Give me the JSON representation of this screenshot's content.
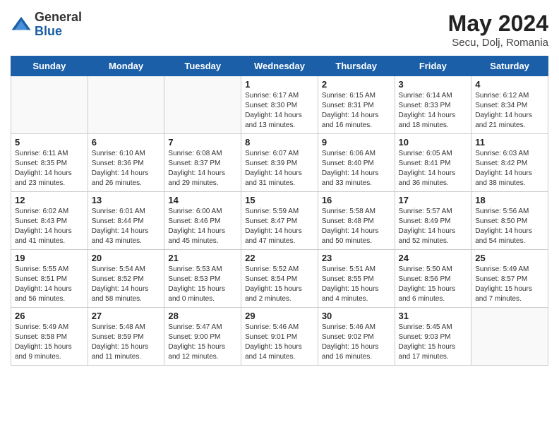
{
  "logo": {
    "general": "General",
    "blue": "Blue"
  },
  "title": {
    "month_year": "May 2024",
    "location": "Secu, Dolj, Romania"
  },
  "days_of_week": [
    "Sunday",
    "Monday",
    "Tuesday",
    "Wednesday",
    "Thursday",
    "Friday",
    "Saturday"
  ],
  "weeks": [
    [
      {
        "day": "",
        "info": ""
      },
      {
        "day": "",
        "info": ""
      },
      {
        "day": "",
        "info": ""
      },
      {
        "day": "1",
        "info": "Sunrise: 6:17 AM\nSunset: 8:30 PM\nDaylight: 14 hours\nand 13 minutes."
      },
      {
        "day": "2",
        "info": "Sunrise: 6:15 AM\nSunset: 8:31 PM\nDaylight: 14 hours\nand 16 minutes."
      },
      {
        "day": "3",
        "info": "Sunrise: 6:14 AM\nSunset: 8:33 PM\nDaylight: 14 hours\nand 18 minutes."
      },
      {
        "day": "4",
        "info": "Sunrise: 6:12 AM\nSunset: 8:34 PM\nDaylight: 14 hours\nand 21 minutes."
      }
    ],
    [
      {
        "day": "5",
        "info": "Sunrise: 6:11 AM\nSunset: 8:35 PM\nDaylight: 14 hours\nand 23 minutes."
      },
      {
        "day": "6",
        "info": "Sunrise: 6:10 AM\nSunset: 8:36 PM\nDaylight: 14 hours\nand 26 minutes."
      },
      {
        "day": "7",
        "info": "Sunrise: 6:08 AM\nSunset: 8:37 PM\nDaylight: 14 hours\nand 29 minutes."
      },
      {
        "day": "8",
        "info": "Sunrise: 6:07 AM\nSunset: 8:39 PM\nDaylight: 14 hours\nand 31 minutes."
      },
      {
        "day": "9",
        "info": "Sunrise: 6:06 AM\nSunset: 8:40 PM\nDaylight: 14 hours\nand 33 minutes."
      },
      {
        "day": "10",
        "info": "Sunrise: 6:05 AM\nSunset: 8:41 PM\nDaylight: 14 hours\nand 36 minutes."
      },
      {
        "day": "11",
        "info": "Sunrise: 6:03 AM\nSunset: 8:42 PM\nDaylight: 14 hours\nand 38 minutes."
      }
    ],
    [
      {
        "day": "12",
        "info": "Sunrise: 6:02 AM\nSunset: 8:43 PM\nDaylight: 14 hours\nand 41 minutes."
      },
      {
        "day": "13",
        "info": "Sunrise: 6:01 AM\nSunset: 8:44 PM\nDaylight: 14 hours\nand 43 minutes."
      },
      {
        "day": "14",
        "info": "Sunrise: 6:00 AM\nSunset: 8:46 PM\nDaylight: 14 hours\nand 45 minutes."
      },
      {
        "day": "15",
        "info": "Sunrise: 5:59 AM\nSunset: 8:47 PM\nDaylight: 14 hours\nand 47 minutes."
      },
      {
        "day": "16",
        "info": "Sunrise: 5:58 AM\nSunset: 8:48 PM\nDaylight: 14 hours\nand 50 minutes."
      },
      {
        "day": "17",
        "info": "Sunrise: 5:57 AM\nSunset: 8:49 PM\nDaylight: 14 hours\nand 52 minutes."
      },
      {
        "day": "18",
        "info": "Sunrise: 5:56 AM\nSunset: 8:50 PM\nDaylight: 14 hours\nand 54 minutes."
      }
    ],
    [
      {
        "day": "19",
        "info": "Sunrise: 5:55 AM\nSunset: 8:51 PM\nDaylight: 14 hours\nand 56 minutes."
      },
      {
        "day": "20",
        "info": "Sunrise: 5:54 AM\nSunset: 8:52 PM\nDaylight: 14 hours\nand 58 minutes."
      },
      {
        "day": "21",
        "info": "Sunrise: 5:53 AM\nSunset: 8:53 PM\nDaylight: 15 hours\nand 0 minutes."
      },
      {
        "day": "22",
        "info": "Sunrise: 5:52 AM\nSunset: 8:54 PM\nDaylight: 15 hours\nand 2 minutes."
      },
      {
        "day": "23",
        "info": "Sunrise: 5:51 AM\nSunset: 8:55 PM\nDaylight: 15 hours\nand 4 minutes."
      },
      {
        "day": "24",
        "info": "Sunrise: 5:50 AM\nSunset: 8:56 PM\nDaylight: 15 hours\nand 6 minutes."
      },
      {
        "day": "25",
        "info": "Sunrise: 5:49 AM\nSunset: 8:57 PM\nDaylight: 15 hours\nand 7 minutes."
      }
    ],
    [
      {
        "day": "26",
        "info": "Sunrise: 5:49 AM\nSunset: 8:58 PM\nDaylight: 15 hours\nand 9 minutes."
      },
      {
        "day": "27",
        "info": "Sunrise: 5:48 AM\nSunset: 8:59 PM\nDaylight: 15 hours\nand 11 minutes."
      },
      {
        "day": "28",
        "info": "Sunrise: 5:47 AM\nSunset: 9:00 PM\nDaylight: 15 hours\nand 12 minutes."
      },
      {
        "day": "29",
        "info": "Sunrise: 5:46 AM\nSunset: 9:01 PM\nDaylight: 15 hours\nand 14 minutes."
      },
      {
        "day": "30",
        "info": "Sunrise: 5:46 AM\nSunset: 9:02 PM\nDaylight: 15 hours\nand 16 minutes."
      },
      {
        "day": "31",
        "info": "Sunrise: 5:45 AM\nSunset: 9:03 PM\nDaylight: 15 hours\nand 17 minutes."
      },
      {
        "day": "",
        "info": ""
      }
    ]
  ]
}
